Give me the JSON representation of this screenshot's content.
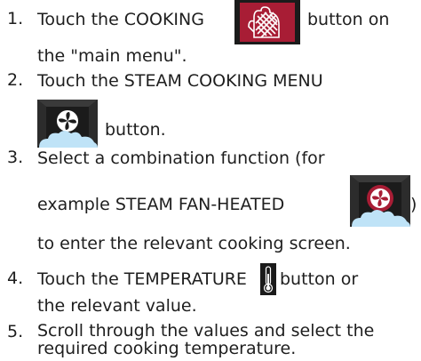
{
  "steps": [
    {
      "number": "1.",
      "line1_before_icon": "Touch the COOKING",
      "line1_after_icon": "button on",
      "line2": "the \"main menu\".",
      "icon": "cooking-glove-icon"
    },
    {
      "number": "2.",
      "line1": "Touch the STEAM COOKING MENU",
      "line2_after_icon": "button.",
      "icon": "steam-fan-icon"
    },
    {
      "number": "3.",
      "line1": "Select a combination function (for",
      "line2_before_icon": "example STEAM FAN-HEATED",
      "line2_after_icon": ")",
      "line3": "to enter the relevant cooking screen.",
      "icon": "steam-fan-heated-icon"
    },
    {
      "number": "4.",
      "line1_before_icon": "Touch the TEMPERATURE",
      "line1_after_icon": "button or",
      "line2": "the relevant value.",
      "icon": "thermometer-icon"
    },
    {
      "number": "5.",
      "line1": "Scroll through the values and select the",
      "line2": "required cooking temperature."
    }
  ],
  "colors": {
    "text": "#1e1e1e",
    "cooking_button_bg": "#a81d35",
    "fan_circle": "#a81d35",
    "button_dark": "#1b1b1b",
    "cloud": "#bfe3f7"
  }
}
